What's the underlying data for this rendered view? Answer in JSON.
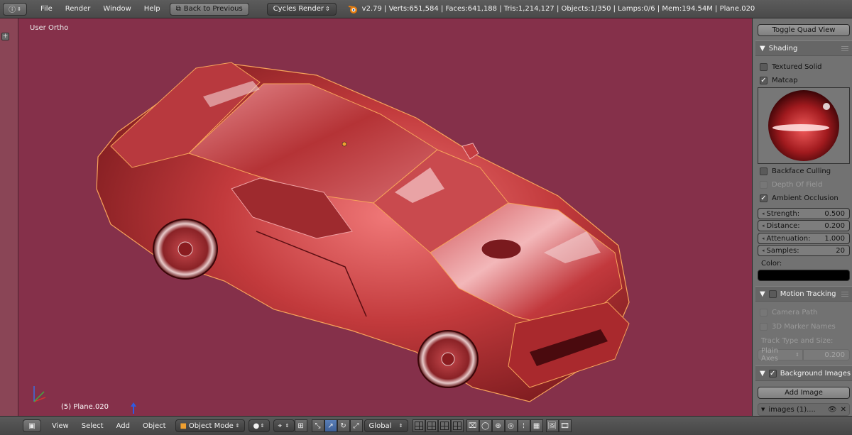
{
  "topbar": {
    "menus": [
      "File",
      "Render",
      "Window",
      "Help"
    ],
    "back_button": "Back to Previous",
    "render_engine": "Cycles Render",
    "stats": "v2.79 | Verts:651,584 | Faces:641,188 | Tris:1,214,127 | Objects:1/350 | Lamps:0/6 | Mem:194.54M | Plane.020"
  },
  "viewport": {
    "view_label": "User Ortho",
    "object_label": "(5) Plane.020",
    "background_color": "#85304a"
  },
  "panel": {
    "toggle_quad_view": "Toggle Quad View",
    "shading": {
      "title": "Shading",
      "textured_solid": {
        "label": "Textured Solid",
        "checked": false
      },
      "matcap": {
        "label": "Matcap",
        "checked": true
      },
      "backface_culling": {
        "label": "Backface Culling",
        "checked": false
      },
      "depth_of_field": {
        "label": "Depth Of Field",
        "checked": false
      },
      "ambient_occlusion": {
        "label": "Ambient Occlusion",
        "checked": true
      },
      "fields": [
        {
          "label": "Strength:",
          "value": "0.500"
        },
        {
          "label": "Distance:",
          "value": "0.200"
        },
        {
          "label": "Attenuation:",
          "value": "1.000"
        },
        {
          "label": "Samples:",
          "value": "20"
        }
      ],
      "color_label": "Color:",
      "color_value": "#000000"
    },
    "motion_tracking": {
      "title": "Motion Tracking",
      "camera_path": "Camera Path",
      "marker_names": "3D Marker Names",
      "track_type_label": "Track Type and Size:",
      "track_type": "Plain Axes",
      "track_size": "0.200"
    },
    "background_images": {
      "title": "Background Images",
      "add_image": "Add Image",
      "image_entry": "images (1)...."
    }
  },
  "bottombar": {
    "menus": [
      "View",
      "Select",
      "Add",
      "Object"
    ],
    "mode": "Object Mode",
    "orientation": "Global"
  }
}
